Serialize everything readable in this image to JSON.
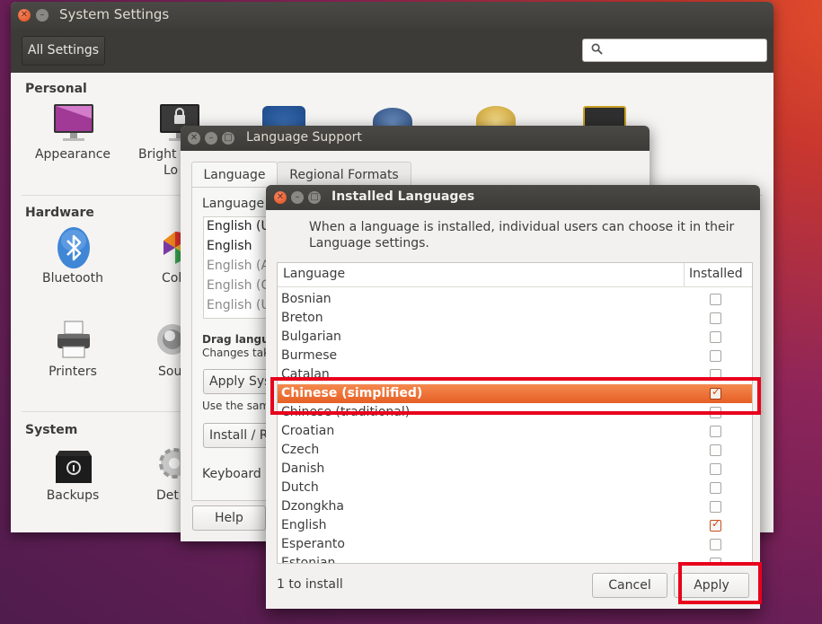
{
  "system_settings": {
    "title": "System Settings",
    "all_settings_label": "All Settings",
    "search": {
      "value": "",
      "icon": "search-icon"
    },
    "sections": [
      {
        "label": "Personal",
        "items": [
          {
            "label": "Appearance",
            "icon": "appearance-icon"
          },
          {
            "label": "Bright…Lo…",
            "label_line1": "Bright",
            "label_line2": "Lo",
            "icon": "lock-icon"
          }
        ]
      },
      {
        "label": "Hardware",
        "items": [
          {
            "label": "Bluetooth",
            "icon": "bluetooth-icon"
          },
          {
            "label": "Col",
            "icon": "color-icon"
          },
          {
            "label": "Printers",
            "icon": "printer-icon"
          },
          {
            "label": "Sou",
            "icon": "sound-icon"
          }
        ]
      },
      {
        "label": "System",
        "items": [
          {
            "label": "Backups",
            "icon": "backup-icon"
          },
          {
            "label": "Det",
            "icon": "details-icon"
          }
        ]
      }
    ]
  },
  "language_support": {
    "title": "Language Support",
    "tabs": [
      {
        "label": "Language",
        "active": true
      },
      {
        "label": "Regional Formats",
        "active": false
      }
    ],
    "language_label": "Language",
    "languages": [
      "English (U",
      "English",
      "English (A",
      "English (C",
      "English (U"
    ],
    "drag_hint_bold": "Drag langua",
    "drag_hint_sub": "Changes take",
    "apply_system_wide": "Apply Sys",
    "use_same": "Use the same",
    "install_remove": "Install / R",
    "keyboard_input": "Keyboard i",
    "help": "Help"
  },
  "installed_languages": {
    "title": "Installed Languages",
    "description": "When a language is installed, individual users can choose it in their Language settings.",
    "columns": {
      "language": "Language",
      "installed": "Installed"
    },
    "rows": [
      {
        "name": "Bosnian",
        "installed": false
      },
      {
        "name": "Breton",
        "installed": false
      },
      {
        "name": "Bulgarian",
        "installed": false
      },
      {
        "name": "Burmese",
        "installed": false
      },
      {
        "name": "Catalan",
        "installed": false
      },
      {
        "name": "Chinese (simplified)",
        "installed": true,
        "selected": true
      },
      {
        "name": "Chinese (traditional)",
        "installed": false
      },
      {
        "name": "Croatian",
        "installed": false
      },
      {
        "name": "Czech",
        "installed": false
      },
      {
        "name": "Danish",
        "installed": false
      },
      {
        "name": "Dutch",
        "installed": false
      },
      {
        "name": "Dzongkha",
        "installed": false
      },
      {
        "name": "English",
        "installed": true
      },
      {
        "name": "Esperanto",
        "installed": false
      },
      {
        "name": "Estonian",
        "installed": false
      }
    ],
    "status": "1 to install",
    "cancel": "Cancel",
    "apply": "Apply"
  },
  "colors": {
    "accent": "#e65f24",
    "highlight_box": "#e8001c"
  }
}
